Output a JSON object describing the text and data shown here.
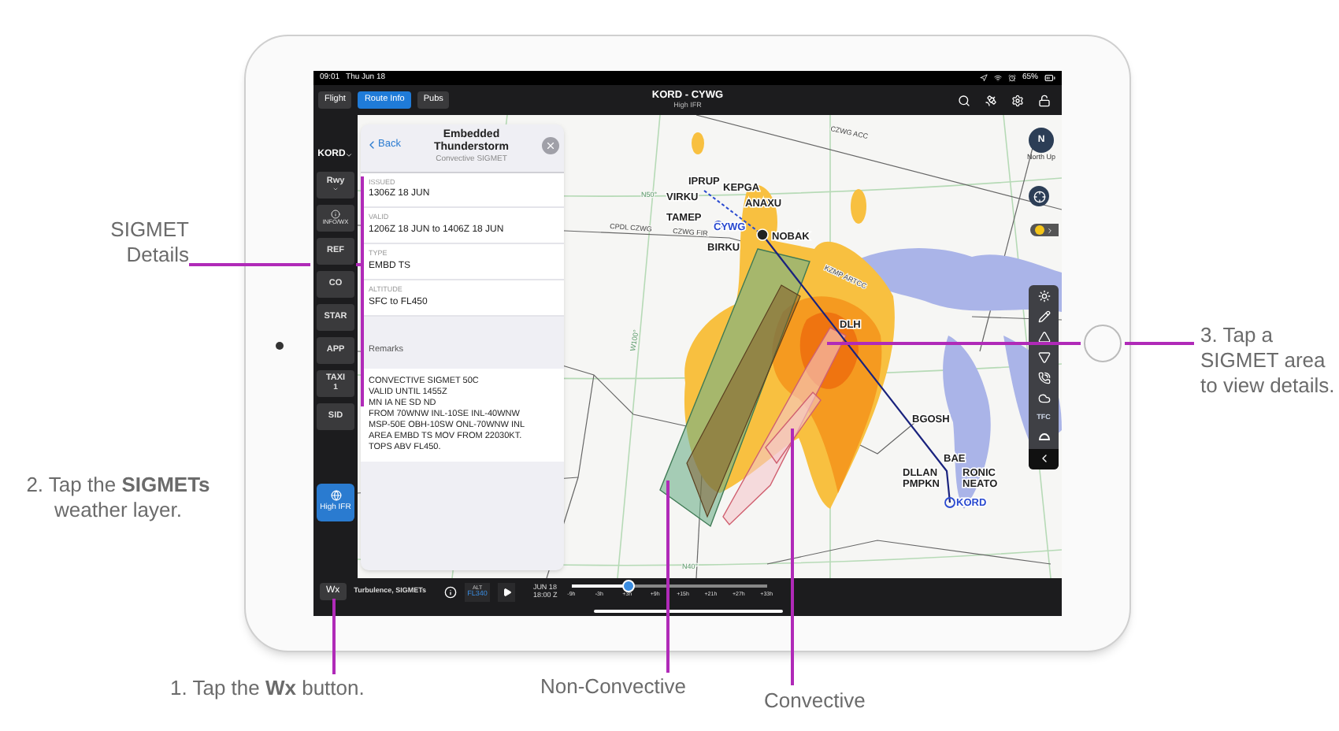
{
  "status_bar": {
    "time": "09:01",
    "date": "Thu Jun 18",
    "battery": "65%"
  },
  "nav": {
    "tabs": [
      {
        "label": "Flight",
        "selected": false
      },
      {
        "label": "Route Info",
        "selected": true
      },
      {
        "label": "Pubs",
        "selected": false
      }
    ],
    "title": "KORD - CYWG",
    "subtitle": "High IFR"
  },
  "sidebar": {
    "airport": "KORD",
    "items": [
      {
        "kind": "dropdown",
        "label": "Rwy"
      },
      {
        "kind": "info",
        "label": "INFO/WX"
      },
      {
        "kind": "plain",
        "label": "REF"
      },
      {
        "kind": "plain",
        "label": "CO"
      },
      {
        "kind": "plain",
        "label": "STAR"
      },
      {
        "kind": "plain",
        "label": "APP"
      },
      {
        "kind": "count",
        "label": "TAXI",
        "count": "1"
      },
      {
        "kind": "plain",
        "label": "SID"
      }
    ],
    "layer_button": {
      "label": "High IFR",
      "selected": true
    }
  },
  "sigmet_panel": {
    "back": "Back",
    "title": "Embedded Thunderstorm",
    "subtitle": "Convective SIGMET",
    "fields": [
      {
        "label": "ISSUED",
        "value": "1306Z 18 JUN"
      },
      {
        "label": "VALID",
        "value": "1206Z 18 JUN to 1406Z 18 JUN"
      },
      {
        "label": "TYPE",
        "value": "EMBD TS"
      },
      {
        "label": "ALTITUDE",
        "value": "SFC to FL450"
      }
    ],
    "remarks_heading": "Remarks",
    "remarks": [
      "CONVECTIVE SIGMET 50C",
      "VALID UNTIL 1455Z",
      "MN IA NE SD ND",
      "FROM 70WNW INL-10SE INL-40WNW",
      "MSP-50E OBH-10SW ONL-70WNW INL",
      "AREA EMBD TS MOV FROM 22030KT.",
      "TOPS ABV FL450."
    ]
  },
  "map": {
    "waypoints": [
      {
        "label": "IPRUP",
        "kind": "fix"
      },
      {
        "label": "KEPGA",
        "kind": "fix"
      },
      {
        "label": "VIRKU",
        "kind": "fix"
      },
      {
        "label": "ANAXU",
        "kind": "fix"
      },
      {
        "label": "TAMEP",
        "kind": "fix"
      },
      {
        "label": "NOBAK",
        "kind": "fix"
      },
      {
        "label": "CYWG",
        "kind": "airport"
      },
      {
        "label": "BIRKU",
        "kind": "fix"
      },
      {
        "label": "DLH",
        "kind": "fix"
      },
      {
        "label": "BGOSH",
        "kind": "fix"
      },
      {
        "label": "BAE",
        "kind": "fix"
      },
      {
        "label": "RONIC",
        "kind": "fix"
      },
      {
        "label": "NEATO",
        "kind": "fix"
      },
      {
        "label": "DLLAN",
        "kind": "fix"
      },
      {
        "label": "PMPKN",
        "kind": "fix"
      },
      {
        "label": "KORD",
        "kind": "airport"
      }
    ],
    "grid_labels": [
      "N50°",
      "W100°",
      "N40°",
      "CZWG ACC",
      "CPDL CZWG",
      "CZWG FIR",
      "KZMP ARTCC"
    ],
    "compass": {
      "label": "N",
      "caption": "North Up"
    },
    "traffic_label": "TFC"
  },
  "bottom_bar": {
    "wx_button": "Wx",
    "layers": "Turbulence, SIGMETs",
    "altitude": {
      "label": "ALT",
      "value": "FL340"
    },
    "date": "JUN 18",
    "time": "18:00 Z",
    "timeline": {
      "ticks": [
        "-9h",
        "-3h",
        "+3h",
        "+9h",
        "+15h",
        "+21h",
        "+27h",
        "+33h"
      ],
      "level": 0.29
    }
  },
  "annotations": [
    {
      "kind": "details",
      "text": "SIGMET Details"
    },
    {
      "kind": "layer",
      "text": "2. Tap the **SIGMETs** weather layer."
    },
    {
      "kind": "area",
      "text": "3. Tap a SIGMET area to view details."
    },
    {
      "kind": "wx",
      "text": "1. Tap the **Wx** button."
    },
    {
      "kind": "non_convective",
      "text": "Non-Convective"
    },
    {
      "kind": "convective",
      "text": "Convective"
    }
  ]
}
